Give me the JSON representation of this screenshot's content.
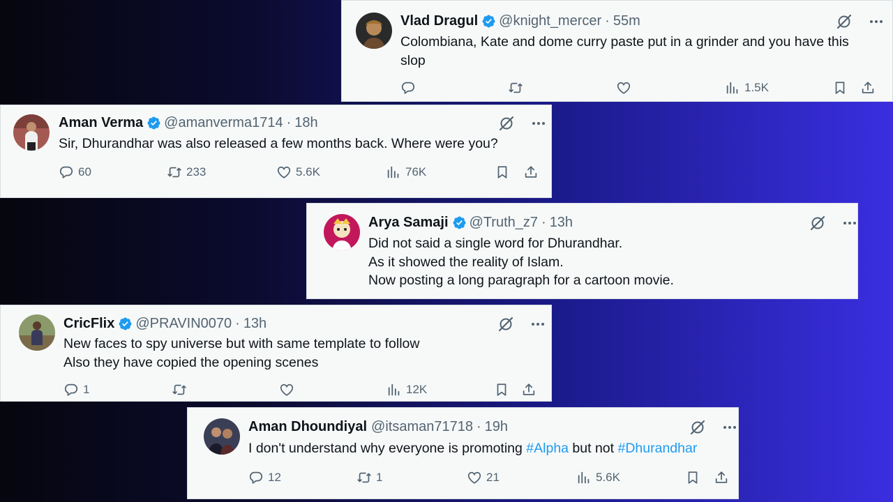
{
  "tweets": [
    {
      "name": "Vlad Dragul",
      "handle": "@knight_mercer",
      "time": "55m",
      "lines": [
        "Colombiana, Kate and dome curry paste put in a grinder and you have  this",
        "slop"
      ],
      "views": "1.5K",
      "replies": "",
      "retweets": "",
      "likes": "",
      "avatar_color": "#6b4a2e"
    },
    {
      "name": "Aman Verma",
      "handle": "@amanverma1714",
      "time": "18h",
      "lines": [
        "Sir, Dhurandhar was also released a few months back. Where were you?"
      ],
      "replies": "60",
      "retweets": "233",
      "likes": "5.6K",
      "views": "76K",
      "avatar_color": "#a45a52"
    },
    {
      "name": "Arya Samaji",
      "handle": "@Truth_z7",
      "time": "13h",
      "lines": [
        "Did not said a single word for Dhurandhar.",
        "As it showed the reality of Islam.",
        "Now posting a long paragraph for a cartoon movie."
      ],
      "avatar_color": "#c2185b"
    },
    {
      "name": "CricFlix",
      "handle": "@PRAVIN0070",
      "time": "13h",
      "lines": [
        "New faces to spy universe but with same template to follow",
        "Also they have copied the opening scenes"
      ],
      "replies": "1",
      "retweets": "",
      "likes": "",
      "views": "12K",
      "avatar_color": "#7a6a4a"
    },
    {
      "name": "Aman Dhoundiyal",
      "handle": "@itsaman71718",
      "time": "19h",
      "line_text": "I don't understand why everyone is promoting ",
      "tag1": "#Alpha",
      "mid": " but not ",
      "tag2": "#Dhurandhar",
      "replies": "12",
      "retweets": "1",
      "likes": "21",
      "views": "5.6K",
      "avatar_color": "#3a3f55"
    }
  ],
  "sep": "·",
  "colors": {
    "accent": "#1d9bf0",
    "muted": "#536471",
    "card_bg": "#f7f9f9"
  },
  "icons": [
    "verified-badge-icon",
    "grok-icon",
    "more-icon",
    "reply-icon",
    "retweet-icon",
    "like-icon",
    "views-icon",
    "bookmark-icon",
    "share-icon"
  ]
}
